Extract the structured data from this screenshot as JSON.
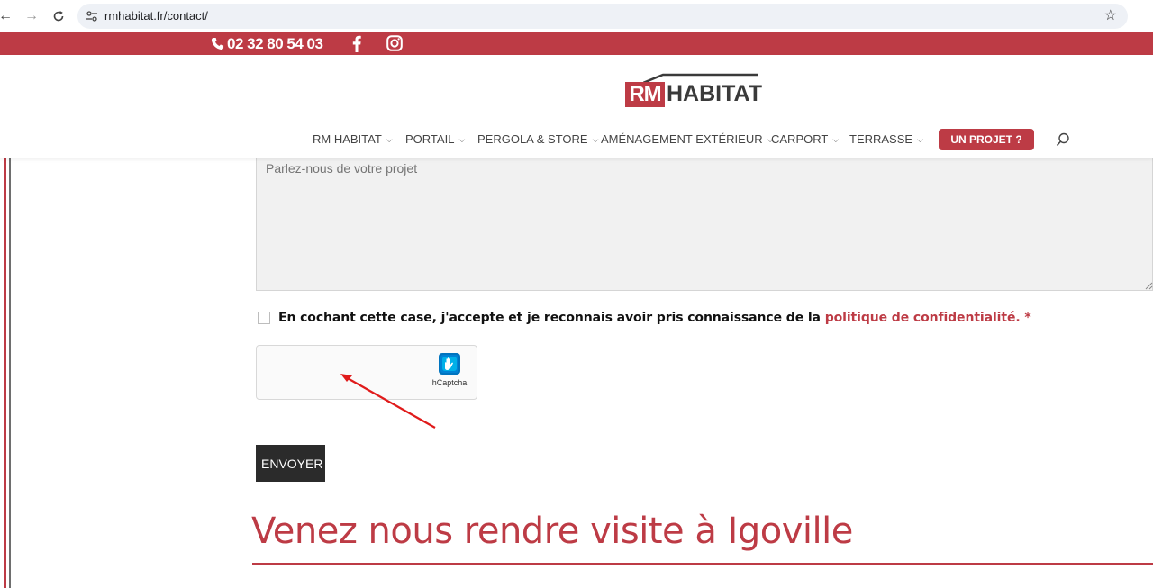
{
  "browser": {
    "url": "rmhabitat.fr/contact/",
    "back_icon": "arrow-left-icon",
    "forward_icon": "arrow-right-icon",
    "reload_icon": "reload-icon",
    "site_info_icon": "tune-icon",
    "bookmark_icon": "star-icon"
  },
  "topbar": {
    "phone": "02 32 80 54 03",
    "phone_icon": "phone-icon",
    "facebook_icon": "facebook-icon",
    "instagram_icon": "instagram-icon",
    "background_color": "#bd3b45"
  },
  "header": {
    "logo": {
      "rm": "RM",
      "habitat": "HABITAT"
    },
    "menu": [
      {
        "label": "RM HABITAT"
      },
      {
        "label": "PORTAIL"
      },
      {
        "label": "PERGOLA & STORE"
      },
      {
        "label": "AMÉNAGEMENT EXTÉRIEUR"
      },
      {
        "label": "CARPORT"
      },
      {
        "label": "TERRASSE"
      }
    ],
    "cta": "UN PROJET ?",
    "search_icon": "search-icon"
  },
  "form": {
    "message_placeholder": "Parlez-nous de votre projet",
    "consent_text": "En cochant cette case, j'accepte et je reconnais avoir pris connaissance de la ",
    "consent_link": "politique de confidentialité.",
    "required_mark": " *",
    "captcha_label": "hCaptcha",
    "submit_label": "ENVOYER"
  },
  "section": {
    "visit_title": "Venez nous rendre visite à Igoville"
  },
  "colors": {
    "accent": "#bd3b45",
    "button_dark": "#2b2b2b"
  }
}
